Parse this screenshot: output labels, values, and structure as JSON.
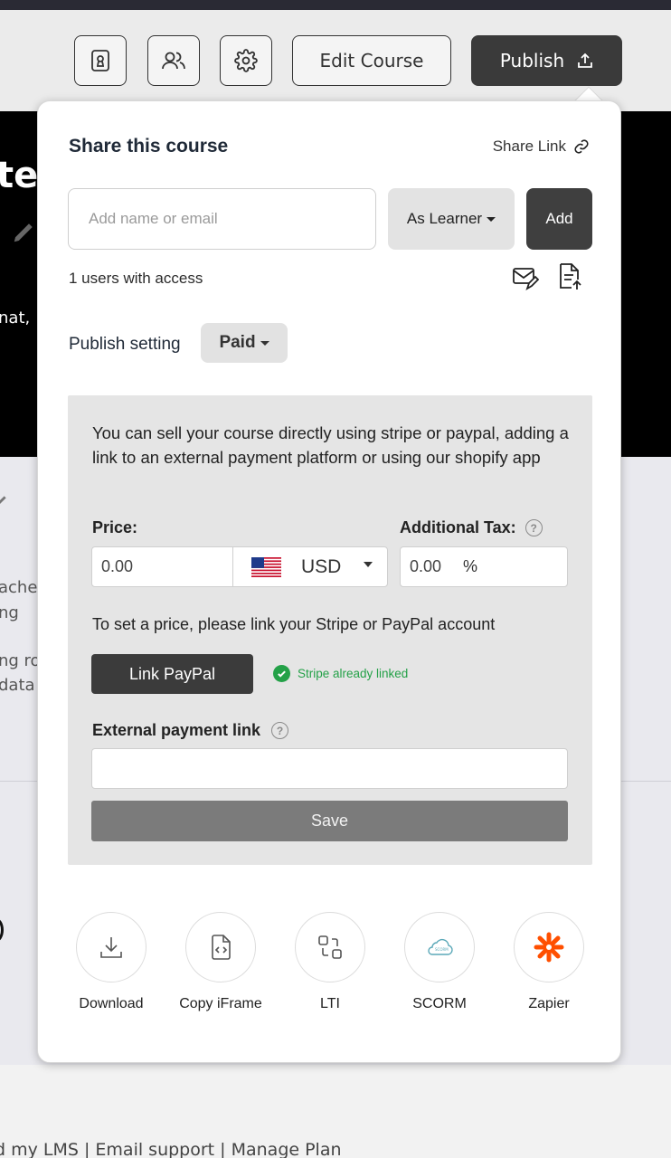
{
  "toolbar": {
    "edit_label": "Edit Course",
    "publish_label": "Publish"
  },
  "background": {
    "hero_fragments": [
      "te",
      "nat,"
    ],
    "body_fragments": [
      "aches",
      "ng",
      "ng ro",
      "data"
    ],
    "footer_text": "d my LMS | Email support | Manage Plan"
  },
  "share": {
    "title": "Share this course",
    "share_link_label": "Share Link",
    "input_placeholder": "Add name or email",
    "role_label": "As Learner",
    "add_label": "Add",
    "access_text": "1 users with access"
  },
  "publish_setting": {
    "label": "Publish setting",
    "value": "Paid"
  },
  "paid_panel": {
    "description": "You can sell your course directly using stripe or paypal, adding a link to an external payment platform or using our shopify app",
    "price_label": "Price:",
    "price_value": "0.00",
    "currency": "USD",
    "tax_label": "Additional Tax:",
    "tax_value": "0.00",
    "tax_unit": "%",
    "link_note": "To set a price, please link your Stripe or PayPal account",
    "paypal_label": "Link PayPal",
    "stripe_status": "Stripe already linked",
    "external_label": "External payment link",
    "external_value": "",
    "save_label": "Save",
    "help_glyph": "?"
  },
  "export_options": [
    {
      "label": "Download",
      "icon": "download-icon"
    },
    {
      "label": "Copy iFrame",
      "icon": "code-file-icon"
    },
    {
      "label": "LTI",
      "icon": "lti-icon"
    },
    {
      "label": "SCORM",
      "icon": "scorm-cloud-icon"
    },
    {
      "label": "Zapier",
      "icon": "zapier-icon"
    }
  ],
  "colors": {
    "dark_button": "#3b3b3b",
    "stripe_green": "#24a148",
    "zapier_orange": "#ff4f00",
    "scorm_teal": "#5aa8b8"
  }
}
